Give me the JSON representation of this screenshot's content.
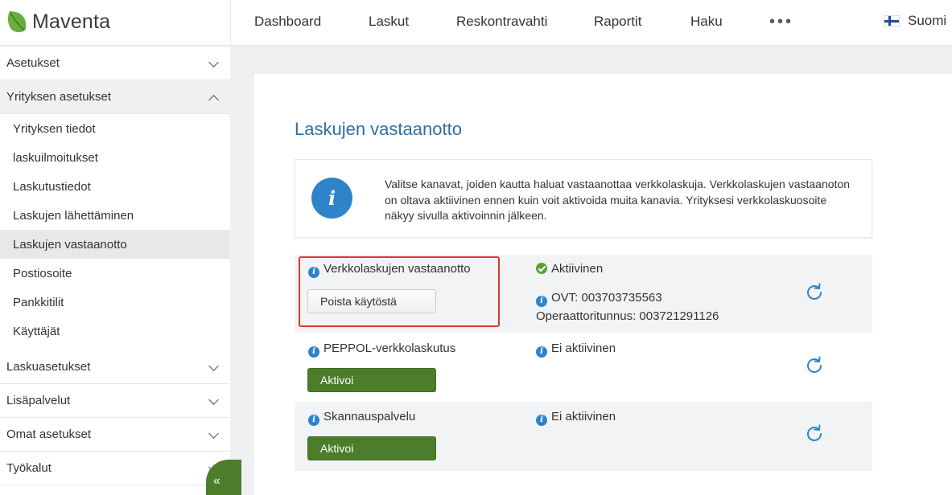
{
  "app": {
    "name": "Maventa"
  },
  "nav": {
    "items": [
      "Dashboard",
      "Laskut",
      "Reskontravahti",
      "Raportit",
      "Haku"
    ],
    "more": "•••",
    "language": "Suomi"
  },
  "sidebar": {
    "asetukset": "Asetukset",
    "yrityksen_asetukset": "Yrityksen asetukset",
    "sub_items": [
      "Yrityksen tiedot",
      "laskuilmoitukset",
      "Laskutustiedot",
      "Laskujen lähettäminen",
      "Laskujen vastaanotto",
      "Postiosoite",
      "Pankkitilit",
      "Käyttäjät"
    ],
    "laskuasetukset": "Laskuasetukset",
    "lisapalvelut": "Lisäpalvelut",
    "omat_asetukset": "Omat asetukset",
    "tyokalut": "Työkalut",
    "collapse": "«"
  },
  "page": {
    "title": "Laskujen vastaanotto",
    "info": "Valitse kanavat, joiden kautta haluat vastaanottaa verkkolaskuja. Verkkolaskujen vastaanoton on oltava aktiivinen ennen kuin voit aktivoida muita kanavia. Yrityksesi verkkolaskuosoite näkyy sivulla aktivoinnin jälkeen."
  },
  "channels": {
    "verkkolaskut": {
      "name": "Verkkolaskujen vastaanotto",
      "status": "Aktiivinen",
      "ovt": "OVT: 003703735563",
      "operator": "Operaattoritunnus: 003721291126",
      "button": "Poista käytöstä"
    },
    "peppol": {
      "name": "PEPPOL-verkkolaskutus",
      "status": "Ei aktiivinen",
      "button": "Aktivoi"
    },
    "skannaus": {
      "name": "Skannauspalvelu",
      "status": "Ei aktiivinen",
      "button": "Aktivoi"
    }
  },
  "colors": {
    "brand_green": "#4c7d2b",
    "link_blue": "#2d6ea8",
    "info_blue": "#2f84c9",
    "status_green": "#5aa031",
    "highlight_red": "#d9392f"
  }
}
